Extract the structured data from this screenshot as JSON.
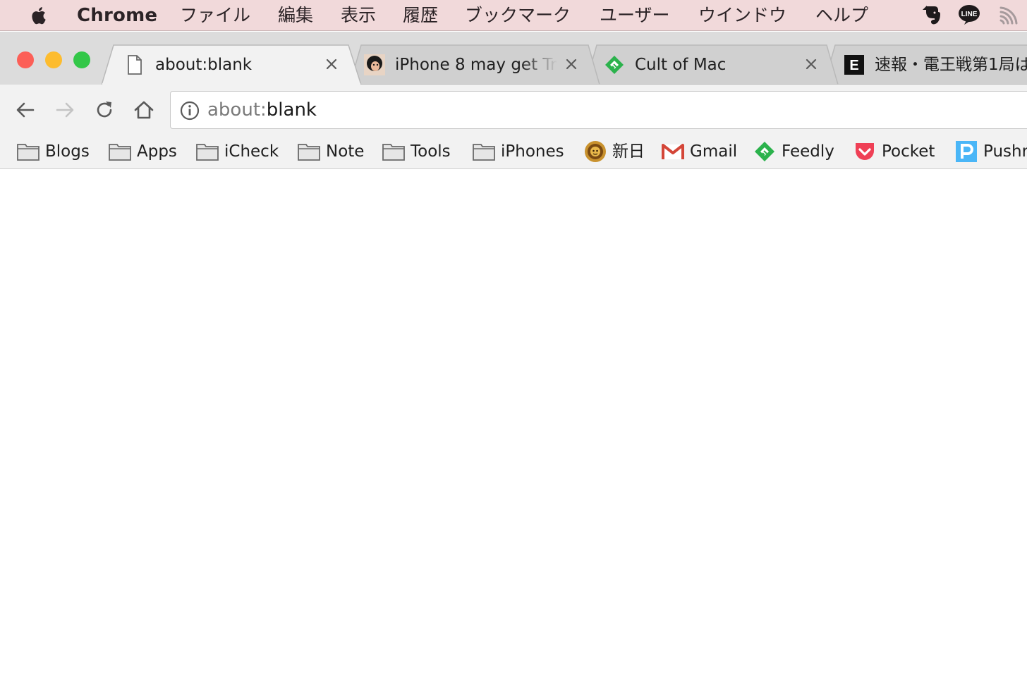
{
  "menubar": {
    "app_name": "Chrome",
    "items": [
      "ファイル",
      "編集",
      "表示",
      "履歴",
      "ブックマーク",
      "ユーザー",
      "ウインドウ",
      "ヘルプ"
    ],
    "status_icons": [
      "evernote-icon",
      "line-icon",
      "wifi-icon"
    ],
    "line_label": "LINE"
  },
  "window_controls": {
    "close_color": "#fc5f57",
    "minimize_color": "#fdbc2e",
    "zoom_color": "#33c748"
  },
  "tabs": [
    {
      "title": "about:blank",
      "favicon": "blank-page-icon",
      "active": true
    },
    {
      "title": "iPhone 8 may get Tr",
      "favicon": "avatar-favicon",
      "active": false
    },
    {
      "title": "Cult of Mac",
      "favicon": "feedly-icon",
      "active": false
    },
    {
      "title": "速報・電王戦第1局は",
      "favicon": "engadget-icon",
      "favicon_letter": "E",
      "active": false
    }
  ],
  "toolbar": {
    "back": "back-arrow-icon",
    "forward": "forward-arrow-icon",
    "reload": "reload-icon",
    "home": "home-icon"
  },
  "omnibox": {
    "scheme": "about:",
    "rest": "blank"
  },
  "bookmarks": [
    {
      "label": "Blogs",
      "icon": "folder-icon"
    },
    {
      "label": "Apps",
      "icon": "folder-icon"
    },
    {
      "label": "iCheck",
      "icon": "folder-icon"
    },
    {
      "label": "Note",
      "icon": "folder-icon"
    },
    {
      "label": "Tools",
      "icon": "folder-icon"
    },
    {
      "label": "iPhones",
      "icon": "folder-icon"
    },
    {
      "label": "新日",
      "icon": "lion-mark-icon"
    },
    {
      "label": "Gmail",
      "icon": "gmail-icon"
    },
    {
      "label": "Feedly",
      "icon": "feedly-icon"
    },
    {
      "label": "Pocket",
      "icon": "pocket-icon"
    },
    {
      "label": "Pushr",
      "icon": "pushbullet-icon"
    }
  ],
  "colors": {
    "menubar_bg": "#f1d9da",
    "feedly_green": "#2bb24c",
    "gmail_red": "#d44638",
    "pocket_red": "#ef4056",
    "pushbullet_blue": "#4ab6f7"
  }
}
